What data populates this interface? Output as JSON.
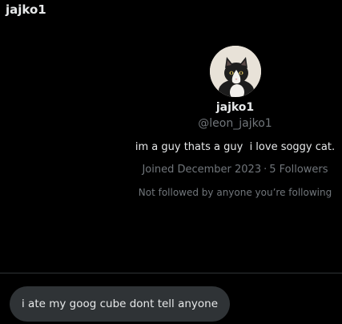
{
  "header": {
    "title": "jajko1"
  },
  "profile": {
    "display_name": "jajko1",
    "handle": "@leon_jajko1",
    "bio": "im a guy thats a guy  i love soggy cat.",
    "joined": "Joined December 2023",
    "separator": "·",
    "followers": "5 Followers",
    "followed_note": "Not followed by anyone you’re following",
    "avatar_icon": "cat-avatar"
  },
  "messages": [
    {
      "text": "i ate my goog cube dont tell anyone"
    }
  ],
  "colors": {
    "background": "#000000",
    "primary_text": "#e7e9ea",
    "secondary_text": "#71767b",
    "bubble": "#2f3336",
    "divider": "#2f3336"
  }
}
